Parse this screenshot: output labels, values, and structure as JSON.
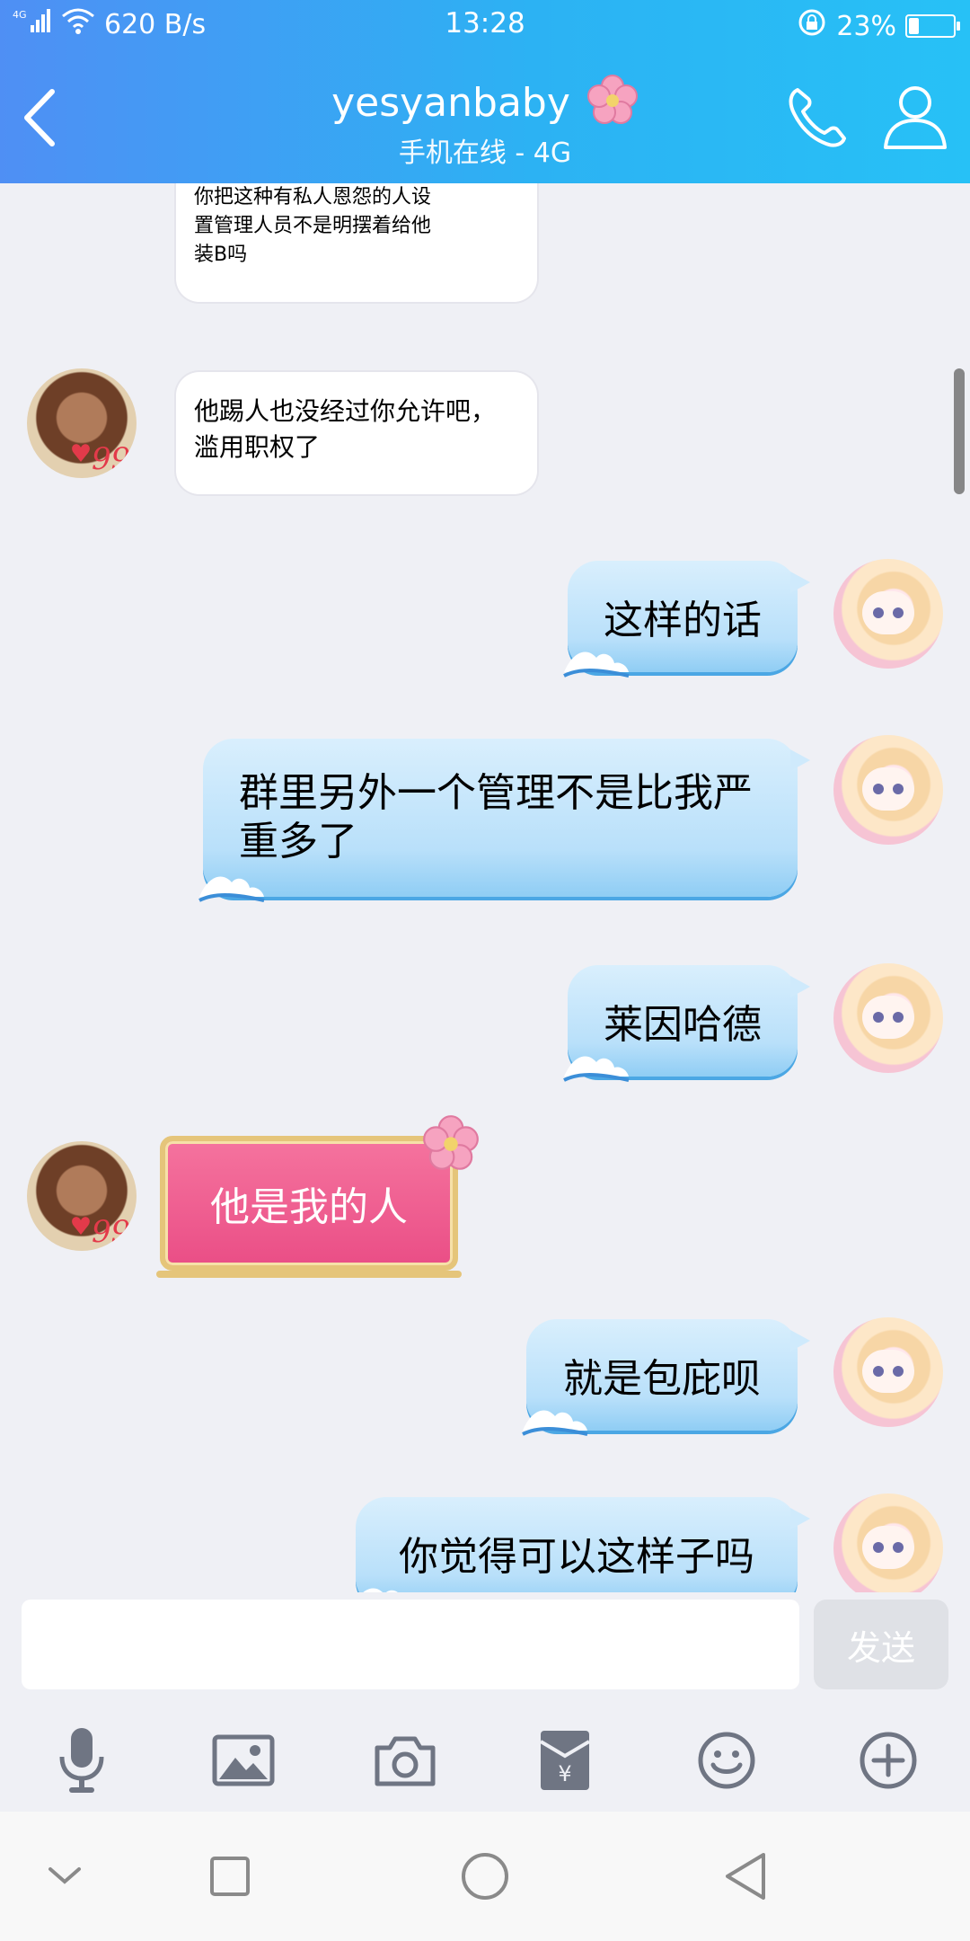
{
  "status": {
    "network": "4G",
    "speed": "620 B/s",
    "time": "13:28",
    "battery": "23%",
    "battery_level": 0.23
  },
  "header": {
    "title": "yesyanbaby",
    "subtitle": "手机在线 - 4G"
  },
  "messages": [
    {
      "side": "in",
      "text": "你把这种有私人恩怨的人设置管理人员不是明摆着给他装B吗"
    },
    {
      "side": "in",
      "text": "他踢人也没经过你允许吧，滥用职权了"
    },
    {
      "side": "out",
      "text": "这样的话"
    },
    {
      "side": "out",
      "text": "群里另外一个管理不是比我严重多了"
    },
    {
      "side": "out",
      "text": "莱因哈德"
    },
    {
      "side": "in",
      "text": "他是我的人",
      "style": "pink-frame"
    },
    {
      "side": "out",
      "text": "就是包庇呗"
    },
    {
      "side": "out",
      "text": "你觉得可以这样子吗"
    }
  ],
  "input": {
    "value": "",
    "send_label": "发送"
  },
  "toolbar": {
    "icons": [
      "microphone-icon",
      "image-icon",
      "camera-icon",
      "red-packet-icon",
      "emoji-icon",
      "plus-icon"
    ]
  },
  "system_nav": {
    "icons": [
      "chevron-down-icon",
      "recent-apps-icon",
      "home-icon",
      "back-icon"
    ]
  },
  "colors": {
    "header_start": "#4f8ff4",
    "header_end": "#27c1f6",
    "chat_bg": "#eff0f5",
    "out_bubble": "#b9e0fa",
    "pink_bubble": "#ea4e86"
  }
}
